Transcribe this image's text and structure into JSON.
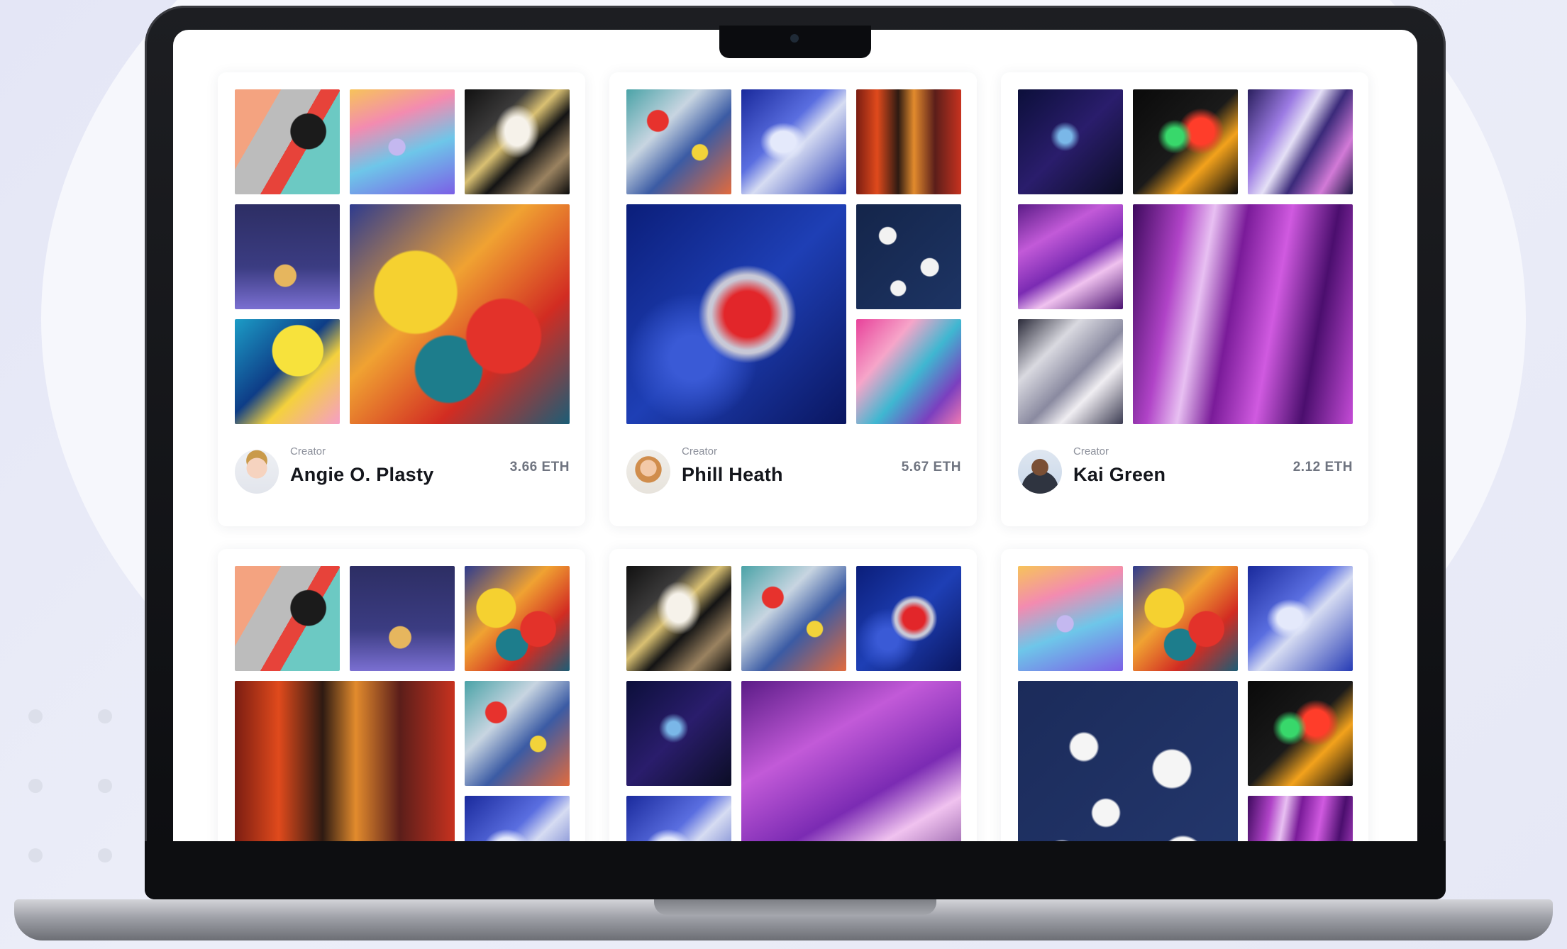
{
  "colors": {
    "background": "#eceef8",
    "screen": "#ffffff",
    "bezel": "#0d0e11",
    "name_text": "#14161c",
    "price_text": "#6f7480"
  },
  "collections": [
    {
      "creator_label": "Creator",
      "creator_name": "Angie O. Plasty",
      "price": "3.66 ETH",
      "avatar_icon": "woman-avatar-icon"
    },
    {
      "creator_label": "Creator",
      "creator_name": "Phill Heath",
      "price": "5.67 ETH",
      "avatar_icon": "woman-avatar-icon"
    },
    {
      "creator_label": "Creator",
      "creator_name": "Kai Green",
      "price": "2.12 ETH",
      "avatar_icon": "man-avatar-icon"
    }
  ]
}
